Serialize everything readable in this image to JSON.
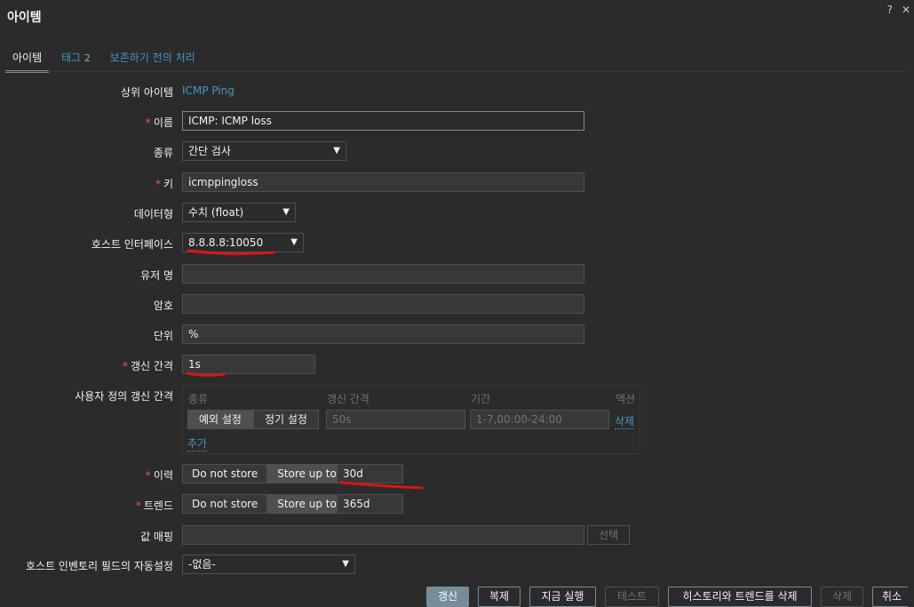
{
  "header": {
    "title": "아이템",
    "help_icon": "?",
    "close_icon": "✕"
  },
  "tabs": [
    {
      "label": "아이템"
    },
    {
      "label": "태그",
      "count": "2"
    },
    {
      "label": "보존하기 전의 처리"
    }
  ],
  "form": {
    "parent_item": {
      "label": "상위 아이템",
      "value": "ICMP Ping"
    },
    "name": {
      "label": "이름",
      "value": "ICMP: ICMP loss"
    },
    "type": {
      "label": "종류",
      "value": "간단 검사"
    },
    "key": {
      "label": "키",
      "value": "icmppingloss"
    },
    "datatype": {
      "label": "데이터형",
      "value": "수치 (float)"
    },
    "interface": {
      "label": "호스트 인터페이스",
      "value": "8.8.8.8:10050"
    },
    "username": {
      "label": "유저 명",
      "value": ""
    },
    "password": {
      "label": "암호",
      "value": ""
    },
    "units": {
      "label": "단위",
      "value": "%"
    },
    "interval": {
      "label": "갱신 간격",
      "value": "1s"
    },
    "custom_intervals": {
      "label": "사용자 정의 갱신 간격",
      "col_type": "종류",
      "col_interval": "갱신 간격",
      "col_period": "기간",
      "col_action": "액션",
      "opt_flexible": "예외 설정",
      "opt_scheduling": "정기 설정",
      "interval_placeholder": "50s",
      "period_placeholder": "1-7,00:00-24:00",
      "remove": "삭제",
      "add": "추가"
    },
    "history": {
      "label": "이력",
      "opt_no": "Do not store",
      "opt_store": "Store up to",
      "value": "30d"
    },
    "trends": {
      "label": "트렌드",
      "opt_no": "Do not store",
      "opt_store": "Store up to",
      "value": "365d"
    },
    "valuemap": {
      "label": "값 매핑",
      "value": "",
      "select": "선택"
    },
    "inventory": {
      "label": "호스트 인벤토리 필드의 자동설정",
      "value": "-없음-"
    }
  },
  "buttons": {
    "update": "갱신",
    "clone": "복제",
    "execute": "지금 실행",
    "test": "테스트",
    "clear": "히스토리와 트렌드를 삭제",
    "delete": "삭제",
    "cancel": "취소"
  },
  "colors": {
    "accent": "#768d99",
    "link": "#4796c4",
    "required": "#e45959",
    "annotation": "#d8161b"
  }
}
